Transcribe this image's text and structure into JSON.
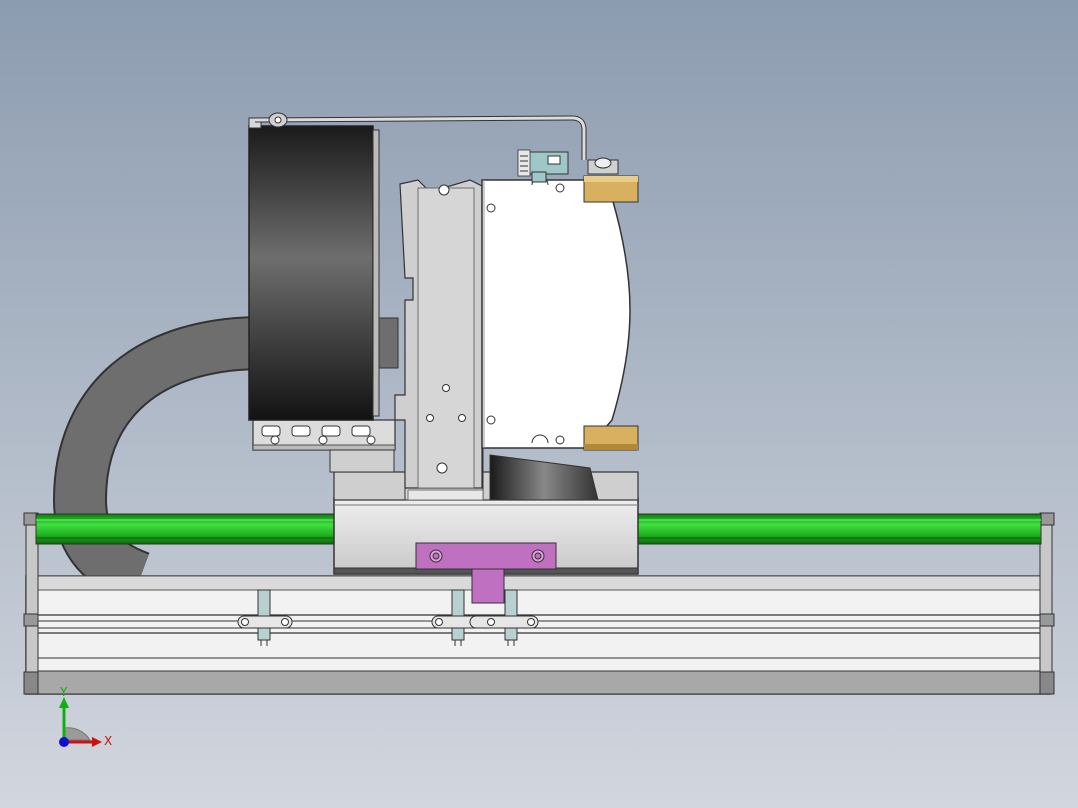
{
  "colors": {
    "bg_top": "#8c9cb0",
    "bg_bottom": "#d2d6de",
    "rail_green": "#28c828",
    "bracket_purple": "#c070c0",
    "clamp_gold": "#d8b060",
    "motor_dark": "#3a3a3a",
    "cable_gray": "#6a6a6a",
    "aluminum": "#d4d4d4",
    "part_white": "#ffffff",
    "tab_teal": "#9ec8c8",
    "axis_x": "#d01010",
    "axis_y": "#10b010",
    "axis_z": "#1010d0"
  },
  "triad": {
    "x_label": "X",
    "y_label": "Y"
  }
}
